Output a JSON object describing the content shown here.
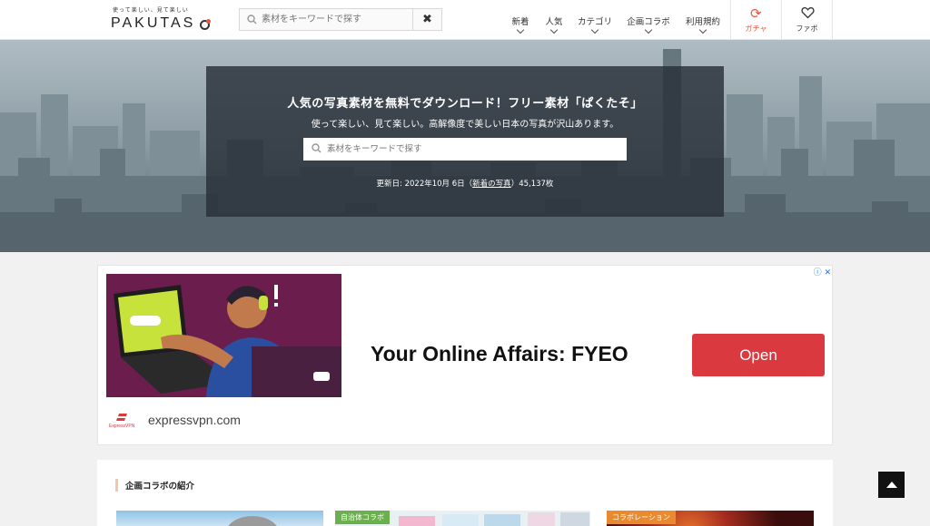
{
  "header": {
    "logo_tagline": "使って楽しい、見て楽しい",
    "logo_text": "PAKUTAS",
    "search_placeholder": "素材をキーワードで探す",
    "nav": [
      {
        "label": "新着"
      },
      {
        "label": "人気"
      },
      {
        "label": "カテゴリ"
      },
      {
        "label": "企画コラボ"
      },
      {
        "label": "利用規約"
      }
    ],
    "gacha_label": "ガチャ",
    "fav_label": "ファボ"
  },
  "hero": {
    "title": "人気の写真素材を無料でダウンロード！フリー素材「ぱくたそ」",
    "subtitle": "使って楽しい、見て楽しい。高解像度で美しい日本の写真が沢山あります。",
    "search_placeholder": "素材をキーワードで探す",
    "updated_prefix": "更新日: 2022年10月 6日（",
    "updated_link": "新着の写真",
    "updated_suffix": "）45,137枚"
  },
  "ad": {
    "headline": "Your Online Affairs: FYEO",
    "button_label": "Open",
    "domain": "expressvpn.com",
    "brand_small": "ExpressVPN"
  },
  "collab": {
    "title": "企画コラボの紹介",
    "thumbs": [
      {
        "tag": ""
      },
      {
        "tag": "自治体コラボ"
      },
      {
        "tag": "コラボレーション"
      }
    ]
  },
  "colors": {
    "accent": "#e9573f",
    "ad_button": "#da3940",
    "tag_green": "#6ab04c",
    "tag_orange": "#e98a2e"
  },
  "icons": [
    "search-icon",
    "clear-icon",
    "refresh-icon",
    "heart-icon",
    "chevron-down-icon",
    "ad-choices-icon",
    "page-top-icon"
  ]
}
